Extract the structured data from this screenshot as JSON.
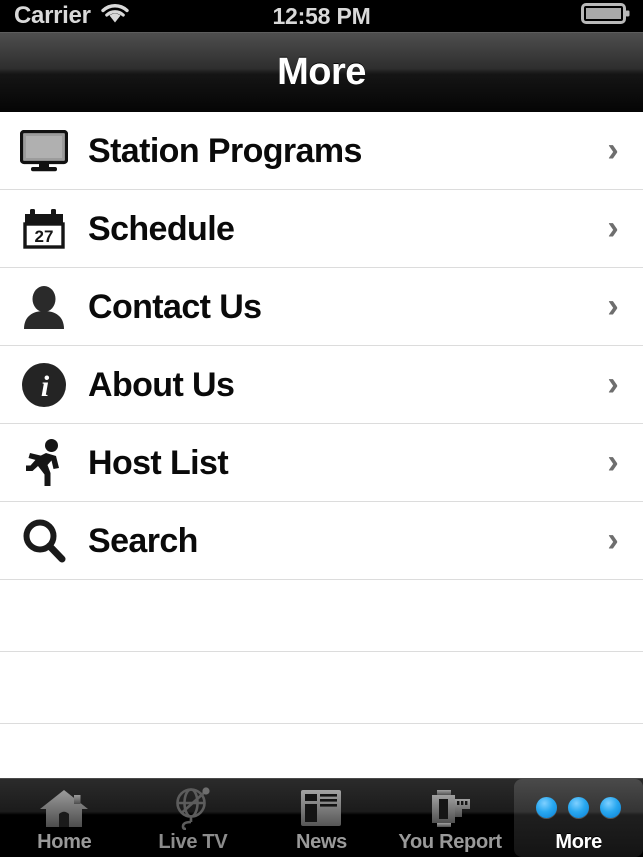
{
  "status_bar": {
    "carrier": "Carrier",
    "wifi_icon": "wifi-icon",
    "time": "12:58 PM",
    "battery_icon": "battery-icon"
  },
  "nav_bar": {
    "title": "More"
  },
  "list": {
    "rows": [
      {
        "icon": "monitor-icon",
        "label": "Station Programs",
        "chevron": "›"
      },
      {
        "icon": "calendar-icon",
        "label": "Schedule",
        "chevron": "›",
        "calendar_day": "27"
      },
      {
        "icon": "person-icon",
        "label": "Contact Us",
        "chevron": "›"
      },
      {
        "icon": "info-icon",
        "label": "About Us",
        "chevron": "›",
        "info_glyph": "i"
      },
      {
        "icon": "runner-icon",
        "label": "Host List",
        "chevron": "›"
      },
      {
        "icon": "search-icon",
        "label": "Search",
        "chevron": "›"
      }
    ],
    "empty_row_count": 3
  },
  "tab_bar": {
    "tabs": [
      {
        "label": "Home",
        "icon": "house-icon",
        "selected": false
      },
      {
        "label": "Live TV",
        "icon": "globe-icon",
        "selected": false
      },
      {
        "label": "News",
        "icon": "news-icon",
        "selected": false
      },
      {
        "label": "You Report",
        "icon": "camera-icon",
        "selected": false
      },
      {
        "label": "More",
        "icon": "three-dots-icon",
        "selected": true
      }
    ]
  },
  "colors": {
    "accent_blue": "#29a8f0",
    "nav_background": "#1b1b1b",
    "list_background": "#ffffff",
    "separator": "#dcdcdc",
    "label_text": "#0a0a0a",
    "chevron": "#6e6e6e",
    "tab_label_inactive": "#9a9a9a",
    "tab_label_active": "#ffffff"
  }
}
